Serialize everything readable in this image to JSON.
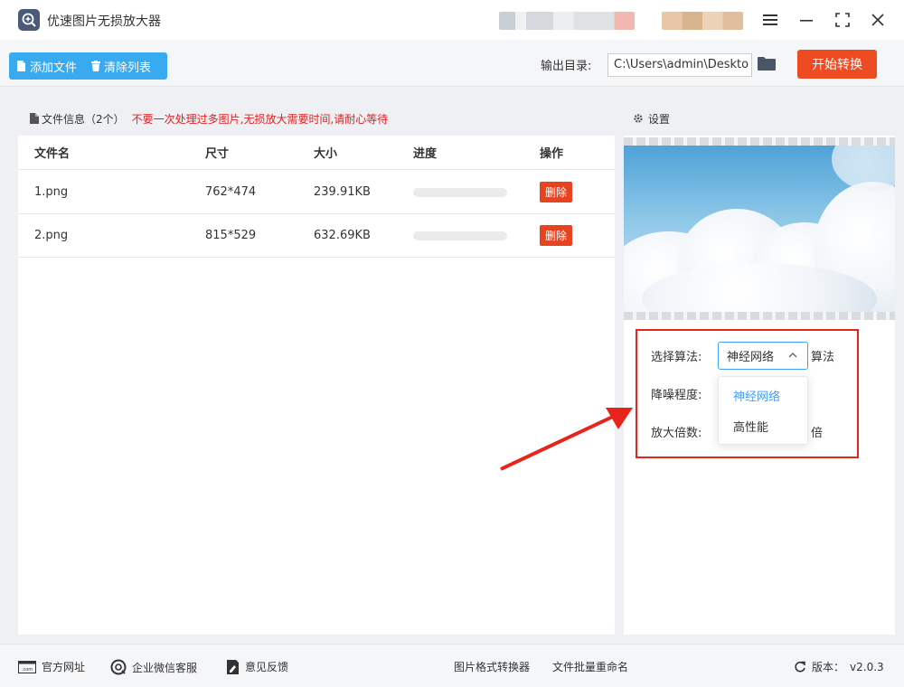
{
  "app": {
    "title": "优速图片无损放大器"
  },
  "toolbar": {
    "add_file": "添加文件",
    "clear_list": "清除列表",
    "output_label": "输出目录:",
    "output_path": "C:\\Users\\admin\\Deskto",
    "start": "开始转换"
  },
  "file_panel": {
    "title": "文件信息（2个）",
    "warning": "不要一次处理过多图片,无损放大需要时间,请耐心等待",
    "headers": {
      "name": "文件名",
      "size": "尺寸",
      "filesize": "大小",
      "progress": "进度",
      "action": "操作"
    },
    "rows": [
      {
        "name": "1.png",
        "size": "762*474",
        "filesize": "239.91KB",
        "progress": 0,
        "action": "删除"
      },
      {
        "name": "2.png",
        "size": "815*529",
        "filesize": "632.69KB",
        "progress": 0,
        "action": "删除"
      }
    ]
  },
  "settings": {
    "title": "设置",
    "algorithm_label": "选择算法:",
    "algorithm_value": "神经网络",
    "algorithm_suffix": "算法",
    "denoise_label": "降噪程度:",
    "scale_label": "放大倍数:",
    "scale_suffix": "倍",
    "options": [
      "神经网络",
      "高性能"
    ]
  },
  "statusbar": {
    "website": "官方网址",
    "wechat": "企业微信客服",
    "feedback": "意见反馈",
    "format_converter": "图片格式转换器",
    "batch_rename": "文件批量重命名",
    "version_label": "版本：",
    "version": "v2.0.3"
  },
  "colors": {
    "primary": "#3aaaf0",
    "danger": "#ee4b22",
    "select_border": "#409eff",
    "highlight": "#e8231c"
  }
}
